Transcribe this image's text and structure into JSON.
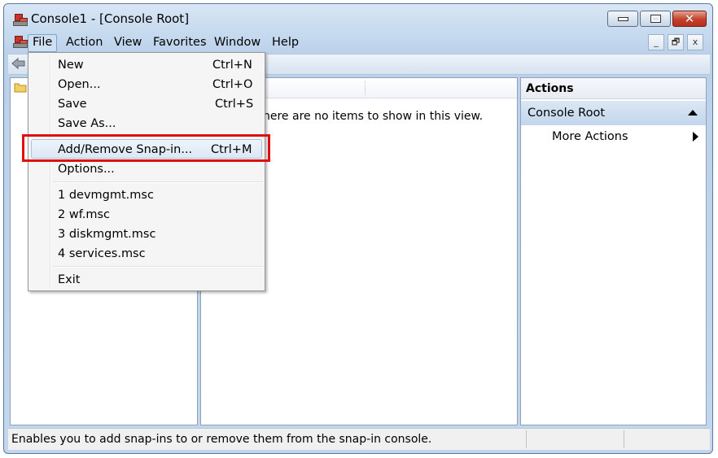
{
  "window": {
    "title": "Console1 - [Console Root]"
  },
  "caption_buttons": {
    "minimize": "–",
    "maximize": "□",
    "close": "✕"
  },
  "menubar": {
    "items": [
      "File",
      "Action",
      "View",
      "Favorites",
      "Window",
      "Help"
    ],
    "mdi_buttons": [
      "_",
      "🗗",
      "x"
    ]
  },
  "file_menu": {
    "items": [
      {
        "label": "New",
        "shortcut": "Ctrl+N"
      },
      {
        "label": "Open...",
        "shortcut": "Ctrl+O"
      },
      {
        "label": "Save",
        "shortcut": "Ctrl+S"
      },
      {
        "label": "Save As...",
        "shortcut": ""
      },
      {
        "label": "Add/Remove Snap-in...",
        "shortcut": "Ctrl+M"
      },
      {
        "label": "Options...",
        "shortcut": ""
      },
      {
        "label": "1 devmgmt.msc",
        "shortcut": ""
      },
      {
        "label": "2 wf.msc",
        "shortcut": ""
      },
      {
        "label": "3 diskmgmt.msc",
        "shortcut": ""
      },
      {
        "label": "4 services.msc",
        "shortcut": ""
      },
      {
        "label": "Exit",
        "shortcut": ""
      }
    ],
    "highlighted": "Add/Remove Snap-in..."
  },
  "center": {
    "empty_message": "here are no items to show in this view."
  },
  "actions_pane": {
    "title": "Actions",
    "group": "Console Root",
    "items": [
      "More Actions"
    ]
  },
  "statusbar": {
    "text": "Enables you to add snap-ins to or remove them from the snap-in console."
  },
  "colors": {
    "highlight_box": "#e01010",
    "accent": "#c2d6ec"
  }
}
